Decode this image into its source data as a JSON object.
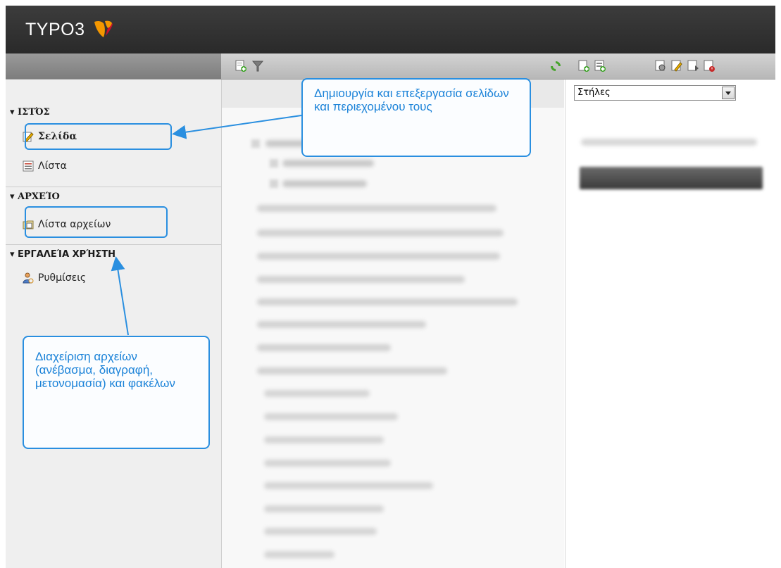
{
  "header": {
    "logo_text": "TYPO3",
    "brand_color": "#f49700"
  },
  "sidebar": {
    "groups": [
      {
        "label": "▾ ΙΣΤΌΣ",
        "items": [
          {
            "label": "Σελίδα",
            "icon": "page-edit-icon"
          },
          {
            "label": "Λίστα",
            "icon": "list-icon"
          }
        ]
      },
      {
        "label": "▾ ΑΡΧΕΊΟ",
        "items": [
          {
            "label": "Λίστα αρχείων",
            "icon": "filelist-icon"
          }
        ]
      },
      {
        "label": "▾ ΕΡΓΑΛΕΊΑ ΧΡΉΣΤΗ",
        "items": [
          {
            "label": "Ρυθμίσεις",
            "icon": "user-settings-icon"
          }
        ]
      }
    ]
  },
  "content": {
    "columns_select": "Στήλες"
  },
  "callouts": {
    "page_module": "Δημιουργία και επεξεργασία σελίδων και περιεχομένου τους",
    "file_module": "Διαχείριση αρχείων (ανέβασμα, διαγραφή, μετονομασία) και φακέλων"
  },
  "colors": {
    "callout": "#2a8fe0",
    "callout_text": "#1a82d8"
  }
}
